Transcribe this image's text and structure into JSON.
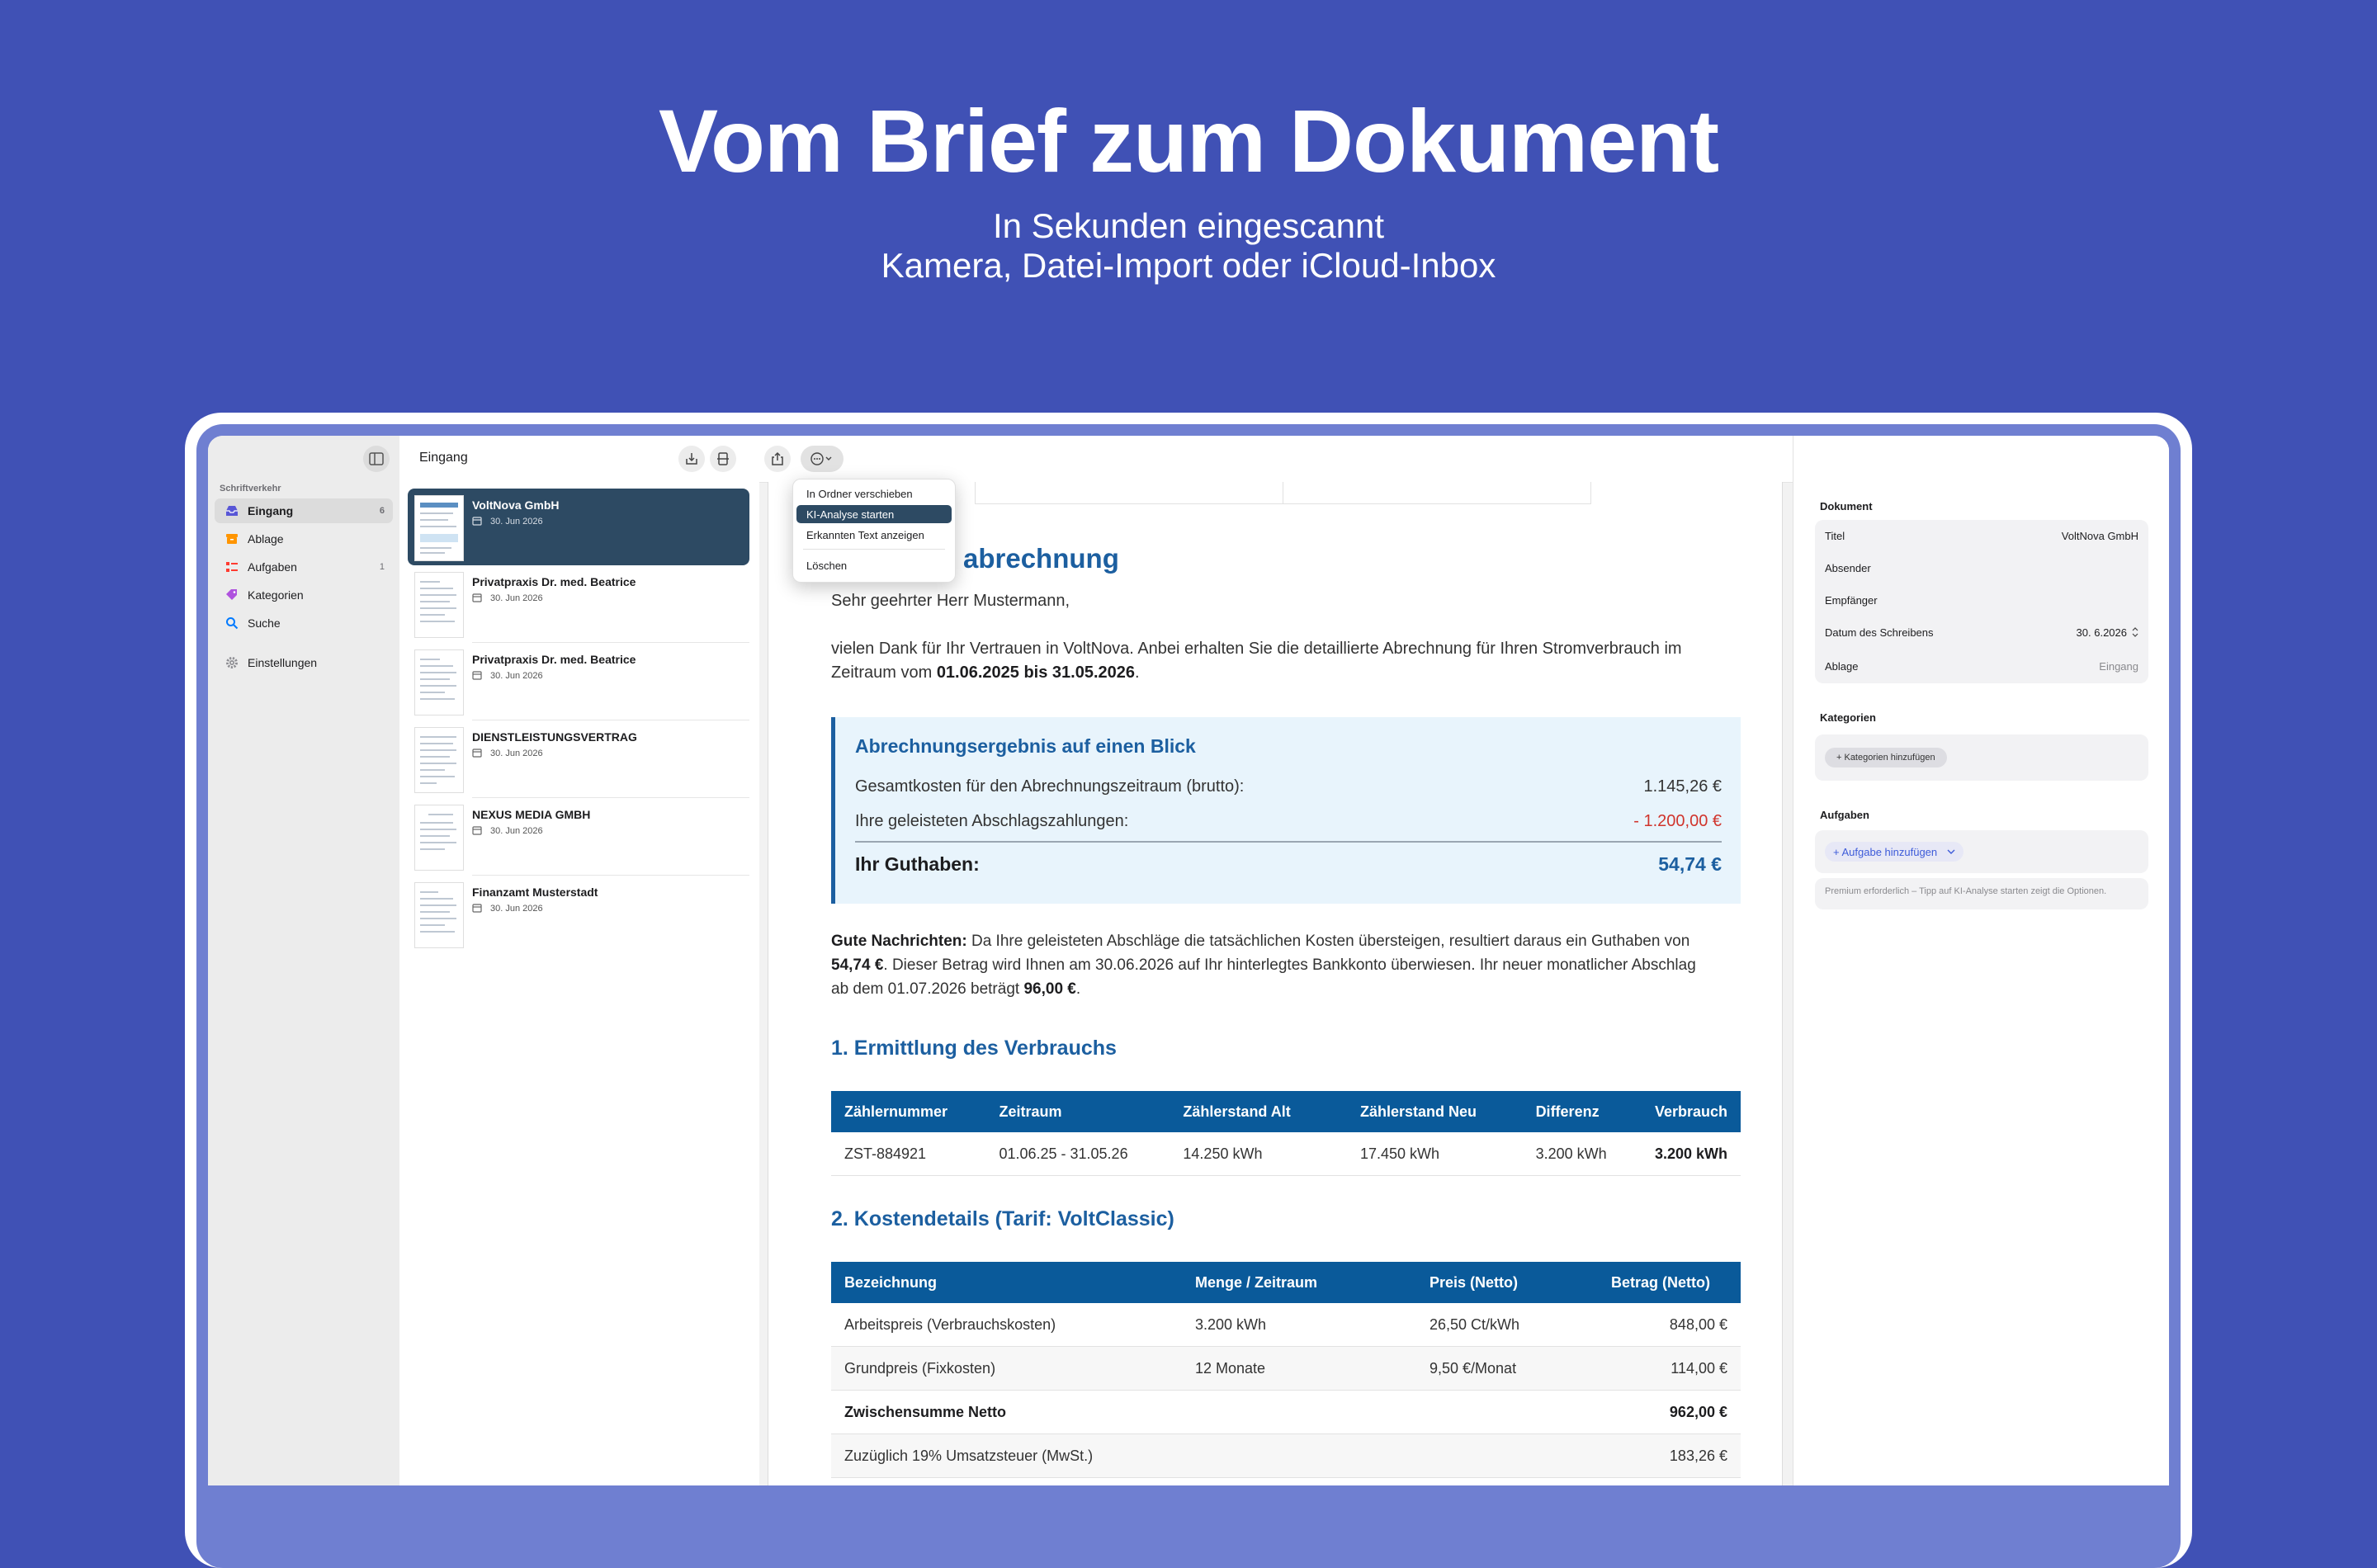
{
  "hero": {
    "title": "Vom Brief zum Dokument",
    "subtitle_1": "In Sekunden eingescannt",
    "subtitle_2": "Kamera, Datei-Import oder iCloud-Inbox"
  },
  "sidebar": {
    "section": "Schriftverkehr",
    "items": [
      {
        "label": "Eingang",
        "count": "6",
        "icon": "tray-icon",
        "color": "#5856d6"
      },
      {
        "label": "Ablage",
        "count": "",
        "icon": "archive-icon",
        "color": "#ff9500"
      },
      {
        "label": "Aufgaben",
        "count": "1",
        "icon": "checklist-icon",
        "color": "#ff3b30"
      },
      {
        "label": "Kategorien",
        "count": "",
        "icon": "tag-icon",
        "color": "#af52de"
      },
      {
        "label": "Suche",
        "count": "",
        "icon": "search-icon",
        "color": "#007aff"
      },
      {
        "label": "Einstellungen",
        "count": "",
        "icon": "gear-icon",
        "color": "#8e8e93"
      }
    ]
  },
  "list": {
    "title": "Eingang",
    "items": [
      {
        "title": "VoltNova GmbH",
        "date": "30. Jun 2026"
      },
      {
        "title": "Privatpraxis Dr. med. Beatrice",
        "date": "30. Jun 2026"
      },
      {
        "title": "Privatpraxis Dr. med. Beatrice",
        "date": "30. Jun 2026"
      },
      {
        "title": "DIENSTLEISTUNGSVERTRAG",
        "date": "30. Jun 2026"
      },
      {
        "title": "NEXUS MEDIA GMBH",
        "date": "30. Jun 2026"
      },
      {
        "title": "Finanzamt Musterstadt",
        "date": "30. Jun 2026"
      }
    ]
  },
  "menu": {
    "items": [
      "In Ordner verschieben",
      "KI-Analyse starten",
      "Erkannten Text anzeigen",
      "Löschen"
    ]
  },
  "document": {
    "heading": "abrechnung",
    "salutation": "Sehr geehrter Herr Mustermann,",
    "intro_1": "vielen Dank für Ihr Vertrauen in VoltNova. Anbei erhalten Sie die detaillierte Abrechnung für Ihren Stromverbrauch im",
    "intro_2_pre": "Zeitraum vom ",
    "intro_2_bold": "01.06.2025 bis 31.05.2026",
    "intro_2_post": ".",
    "summary": {
      "title": "Abrechnungsergebnis auf einen Blick",
      "rows": [
        {
          "label": "Gesamtkosten für den Abrechnungszeitraum (brutto):",
          "value": "1.145,26 €"
        },
        {
          "label": "Ihre geleisteten Abschlagszahlungen:",
          "value": "- 1.200,00 €"
        }
      ],
      "total_label": "Ihr Guthaben:",
      "total_value": "54,74 €"
    },
    "news_bold": "Gute Nachrichten:",
    "news_1": " Da Ihre geleisteten Abschläge die tatsächlichen Kosten übersteigen, resultiert daraus ein Guthaben von",
    "news_2_bold": "54,74 €",
    "news_2": ". Dieser Betrag wird Ihnen am 30.06.2026 auf Ihr hinterlegtes Bankkonto überwiesen. Ihr neuer monatlicher Abschlag",
    "news_3": "ab dem 01.07.2026 beträgt ",
    "news_3_bold": "96,00 €",
    "news_3_post": ".",
    "section_1": "1. Ermittlung des Verbrauchs",
    "table_1": {
      "headers": [
        "Zählernummer",
        "Zeitraum",
        "Zählerstand Alt",
        "Zählerstand Neu",
        "Differenz",
        "Verbrauch"
      ],
      "row": [
        "ZST-884921",
        "01.06.25 - 31.05.26",
        "14.250 kWh",
        "17.450 kWh",
        "3.200 kWh",
        "3.200 kWh"
      ]
    },
    "section_2": "2. Kostendetails (Tarif: VoltClassic)",
    "table_2": {
      "headers": [
        "Bezeichnung",
        "Menge / Zeitraum",
        "Preis (Netto)",
        "Betrag (Netto)"
      ],
      "rows": [
        [
          "Arbeitspreis (Verbrauchskosten)",
          "3.200 kWh",
          "26,50 Ct/kWh",
          "848,00 €"
        ],
        [
          "Grundpreis (Fixkosten)",
          "12 Monate",
          "9,50 €/Monat",
          "114,00 €"
        ],
        [
          "Zwischensumme Netto",
          "",
          "",
          "962,00 €"
        ],
        [
          "Zuzüglich 19% Umsatzsteuer (MwSt.)",
          "",
          "",
          "183,26 €"
        ]
      ]
    }
  },
  "inspector": {
    "doc_header": "Dokument",
    "fields": [
      {
        "label": "Titel",
        "value": "VoltNova GmbH"
      },
      {
        "label": "Absender",
        "value": ""
      },
      {
        "label": "Empfänger",
        "value": ""
      },
      {
        "label": "Datum des Schreibens",
        "value": "30.  6.2026"
      },
      {
        "label": "Ablage",
        "value": "Eingang"
      }
    ],
    "categories_header": "Kategorien",
    "add_category": "+ Kategorien hinzufügen",
    "tasks_header": "Aufgaben",
    "add_task": "+ Aufgabe hinzufügen",
    "premium_note": "Premium erforderlich – Tipp auf KI-Analyse starten zeigt die Optionen."
  }
}
